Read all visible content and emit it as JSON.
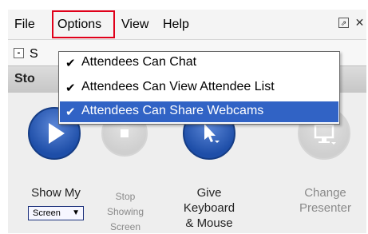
{
  "menu": {
    "file": "File",
    "options": "Options",
    "view": "View",
    "help": "Help"
  },
  "section": {
    "collapse_symbol": "-",
    "label_partial": "S"
  },
  "header": {
    "label_partial": "Sto"
  },
  "dropdown": {
    "items": [
      {
        "label": "Attendees Can Chat",
        "checked": true,
        "selected": false
      },
      {
        "label": "Attendees Can View Attendee List",
        "checked": true,
        "selected": false
      },
      {
        "label": "Attendees Can Share Webcams",
        "checked": true,
        "selected": true
      }
    ],
    "check_glyph": "✔"
  },
  "buttons": {
    "show_my": {
      "label": "Show My",
      "select_value": "Screen"
    },
    "stop": {
      "label_lines": [
        "Stop",
        "Showing",
        "Screen"
      ]
    },
    "give": {
      "label_lines": [
        "Give",
        "Keyboard",
        "& Mouse"
      ]
    },
    "change": {
      "label_lines": [
        "Change",
        "Presenter"
      ]
    }
  },
  "icons": {
    "play": "play-icon",
    "stop": "stop-icon",
    "pointer": "mouse-pointer-icon",
    "presenter": "monitor-icon",
    "popout": "popout-icon",
    "close": "close-icon"
  },
  "colors": {
    "highlight": "#3163c5",
    "annotation_box": "#e0001a",
    "button_blue": "#1e4ea8"
  }
}
